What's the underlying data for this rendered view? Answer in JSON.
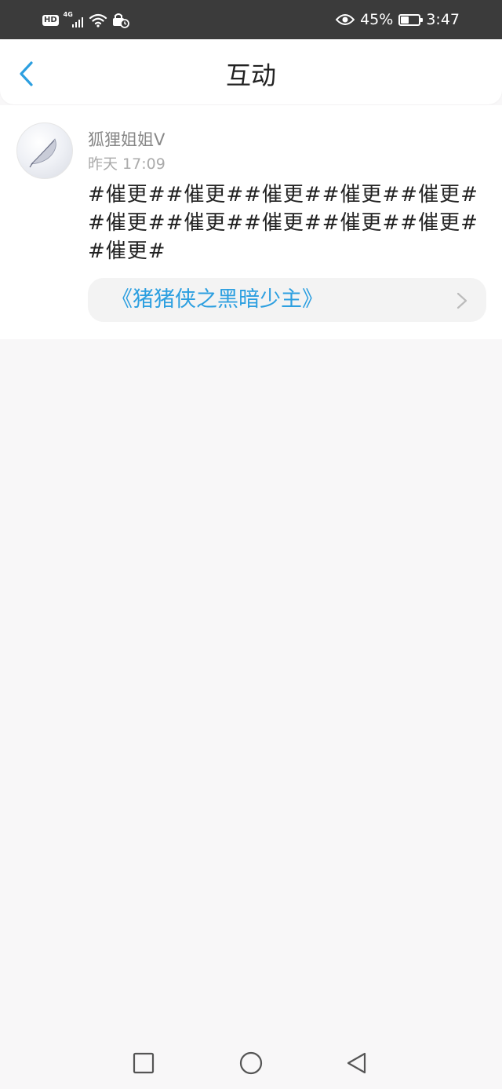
{
  "status_bar": {
    "hd_badge": "HD",
    "network_type": "4G",
    "battery_percent": "45%",
    "battery_level": 0.45,
    "time": "3:47",
    "icons": [
      "hd-icon",
      "signal-icon",
      "wifi-icon",
      "vpn-icon",
      "eye-icon",
      "battery-icon"
    ]
  },
  "header": {
    "title": "互动",
    "back_icon": "chevron-left-icon"
  },
  "post": {
    "username": "狐狸姐姐V",
    "timestamp": "昨天 17:09",
    "content": "#催更##催更##催更##催更##催更##催更##催更##催更##催更##催更##催更#",
    "book_link_text": "《猪猪侠之黑暗少主》",
    "book_link_icon": "chevron-right-icon"
  },
  "navigation": {
    "buttons": [
      "recent-apps",
      "home",
      "back"
    ]
  },
  "colors": {
    "accent": "#2c9fe0",
    "status_bar_bg": "#3b3b3b",
    "page_bg": "#f8f7f8",
    "card_bg": "#ffffff"
  }
}
